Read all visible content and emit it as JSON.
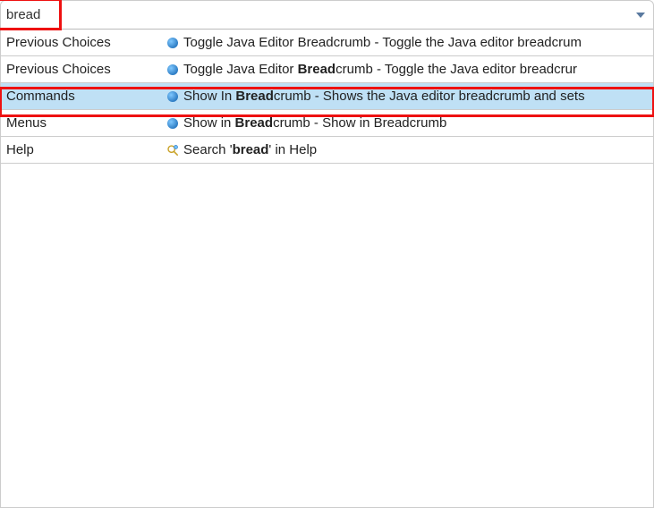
{
  "search": {
    "value": "bread"
  },
  "categories": {
    "previous_choices": "Previous Choices",
    "commands": "Commands",
    "menus": "Menus",
    "help": "Help"
  },
  "rows": [
    {
      "category_key": "previous_choices",
      "icon": "bullet",
      "selected": false,
      "pre": "Toggle Java Editor Breadcrumb - Toggle the Java editor breadcrum",
      "bold": "",
      "post": ""
    },
    {
      "category_key": "previous_choices",
      "icon": "bullet",
      "selected": false,
      "pre": "Toggle Java Editor ",
      "bold": "Bread",
      "post": "crumb - Toggle the Java editor breadcrur"
    },
    {
      "category_key": "commands",
      "icon": "bullet",
      "selected": true,
      "pre": "Show In ",
      "bold": "Bread",
      "post": "crumb - Shows the Java editor breadcrumb and sets"
    },
    {
      "category_key": "menus",
      "icon": "bullet",
      "selected": false,
      "pre": "Show in ",
      "bold": "Bread",
      "post": "crumb - Show in Breadcrumb"
    },
    {
      "category_key": "help",
      "icon": "help",
      "selected": false,
      "pre": "Search '",
      "bold": "bread",
      "post": "' in Help"
    }
  ]
}
